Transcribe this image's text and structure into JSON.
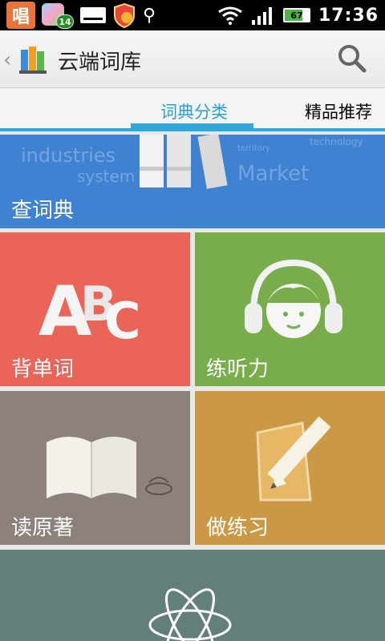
{
  "statusbar": {
    "app_icon_char": "唱",
    "notification_count": "14",
    "battery_level": "67",
    "time": "17:36"
  },
  "actionbar": {
    "back_icon": "chevron-left",
    "title": "云端词库",
    "search_icon": "search"
  },
  "tabs": [
    {
      "label": "词典分类",
      "selected": true
    },
    {
      "label": "精品推荐",
      "selected": false
    }
  ],
  "tiles": {
    "dictionary": {
      "label": "查词典",
      "bg_words": [
        "industries",
        "system",
        "Market",
        "territory",
        "technology"
      ]
    },
    "recite": {
      "label": "背单词"
    },
    "listen": {
      "label": "练听力"
    },
    "read": {
      "label": "读原著"
    },
    "practice": {
      "label": "做练习"
    }
  },
  "colors": {
    "accent": "#30a8d8",
    "dictionary": "#3f82d1",
    "recite": "#ea6457",
    "listen": "#79ad4c",
    "read": "#8d827b",
    "practice": "#cb9846",
    "bottom": "#637f7b"
  }
}
